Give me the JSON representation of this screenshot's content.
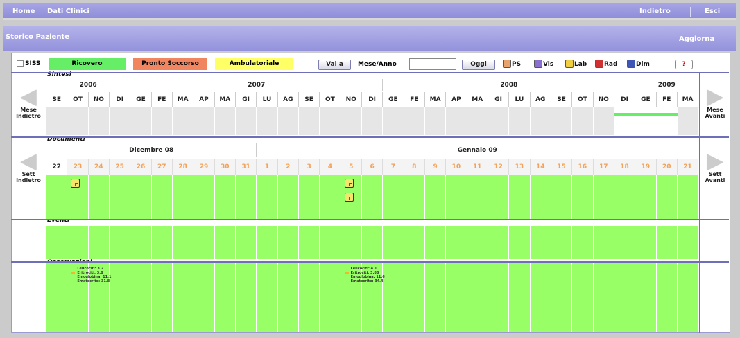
{
  "nav": {
    "home": "Home",
    "dati_clinici": "Dati Clinici",
    "indietro": "Indietro",
    "esci": "Esci"
  },
  "header": {
    "title": "Storico Paziente",
    "refresh": "Aggiorna"
  },
  "toolbar": {
    "siss": "SISS",
    "ricovero": "Ricovero",
    "pronto_soccorso": "Pronto Soccorso",
    "ambulatoriale": "Ambulatoriale",
    "vai_a": "Vai a",
    "mese_anno": "Mese/Anno",
    "mese_anno_value": "",
    "oggi": "Oggi",
    "help": "?"
  },
  "legend": [
    {
      "label": "PS",
      "color": "#e8a26a"
    },
    {
      "label": "Vis",
      "color": "#8a6fd0"
    },
    {
      "label": "Lab",
      "color": "#f0d040"
    },
    {
      "label": "Rad",
      "color": "#d23030"
    },
    {
      "label": "Dim",
      "color": "#3f56b8"
    }
  ],
  "colors": {
    "ricovero": "#66ee66",
    "pronto_soccorso": "#f08560",
    "ambulatoriale": "#ffff66",
    "grid_green": "#99ff66",
    "nav_bar": "#908ed9"
  },
  "sections": {
    "sintesi": "Sintesi",
    "documenti": "Documenti",
    "eventi": "Eventi",
    "osservazioni": "Osservazioni"
  },
  "sintesi": {
    "years": [
      {
        "label": "2006",
        "span": 4
      },
      {
        "label": "2007",
        "span": 12
      },
      {
        "label": "2008",
        "span": 12
      },
      {
        "label": "2009",
        "span": 3
      }
    ],
    "months": [
      "SE",
      "OT",
      "NO",
      "DI",
      "GE",
      "FE",
      "MA",
      "AP",
      "MA",
      "GI",
      "LU",
      "AG",
      "SE",
      "OT",
      "NO",
      "DI",
      "GE",
      "FE",
      "MA",
      "AP",
      "MA",
      "GI",
      "LU",
      "AG",
      "SE",
      "OT",
      "NO",
      "DI",
      "GE",
      "FE",
      "MA"
    ],
    "nav_prev": [
      "Mese",
      "Indietro"
    ],
    "nav_next": [
      "Mese",
      "Avanti"
    ],
    "highlight_from_month_index": 27,
    "highlight_to_month_index": 29
  },
  "documenti": {
    "months": [
      {
        "label": "Dicembre 08",
        "span": 10
      },
      {
        "label": "Gennaio 09",
        "span": 21
      }
    ],
    "days": [
      "22",
      "23",
      "24",
      "25",
      "26",
      "27",
      "28",
      "29",
      "30",
      "31",
      "1",
      "2",
      "3",
      "4",
      "5",
      "6",
      "7",
      "8",
      "9",
      "10",
      "11",
      "12",
      "13",
      "14",
      "15",
      "16",
      "17",
      "18",
      "19",
      "20",
      "21"
    ],
    "nav_prev": [
      "Sett",
      "Indietro"
    ],
    "nav_next": [
      "Sett",
      "Avanti"
    ],
    "docs_per_day": {
      "1": 1,
      "14": 2
    }
  },
  "observations": [
    {
      "day_index": 1,
      "lines": [
        "Leucociti: 3.2",
        "Eritrociti: 3.8",
        "Emoglobina: 11.1",
        "Ematocrito: 31.8"
      ]
    },
    {
      "day_index": 14,
      "lines": [
        "Leucociti: 4.1",
        "Eritrociti: 3.88",
        "Emoglobina: 11.6",
        "Ematocrito: 34.4"
      ]
    }
  ]
}
